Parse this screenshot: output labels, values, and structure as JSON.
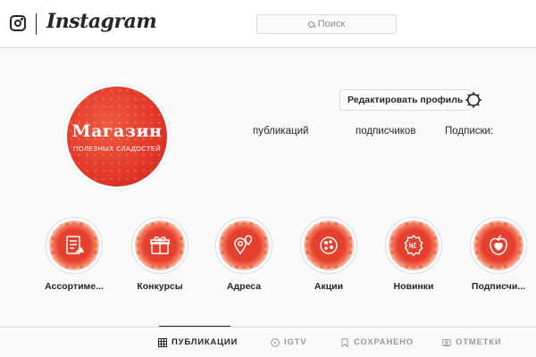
{
  "header": {
    "wordmark": "Instagram",
    "search": {
      "placeholder": "Поиск"
    }
  },
  "profile": {
    "avatar_title": "Магазин",
    "avatar_subtitle": "ПОЛЕЗНЫХ СЛАДОСТЕЙ",
    "edit_label": "Редактировать профиль",
    "stats": {
      "posts": "публикаций",
      "followers": "подписчиков",
      "following": "Подписки:"
    }
  },
  "highlights": [
    {
      "label": "Ассортиме...",
      "icon": "menu-card-icon"
    },
    {
      "label": "Конкурсы",
      "icon": "gift-icon"
    },
    {
      "label": "Адреса",
      "icon": "map-pin-icon"
    },
    {
      "label": "Акции",
      "icon": "cookie-icon"
    },
    {
      "label": "Новинки",
      "icon": "new-badge-icon"
    },
    {
      "label": "Подписчи...",
      "icon": "apple-heart-icon"
    }
  ],
  "tabs": [
    {
      "label": "ПУБЛИКАЦИИ",
      "icon": "grid-icon",
      "active": true
    },
    {
      "label": "IGTV",
      "icon": "tv-icon",
      "active": false
    },
    {
      "label": "СОХРАНЕНО",
      "icon": "bookmark-icon",
      "active": false
    },
    {
      "label": "ОТМЕТКИ",
      "icon": "tag-icon",
      "active": false
    }
  ],
  "colors": {
    "brand_red": "#e53f2e",
    "border": "#dbdbdb",
    "text": "#262626",
    "muted": "#8e8e8e"
  }
}
